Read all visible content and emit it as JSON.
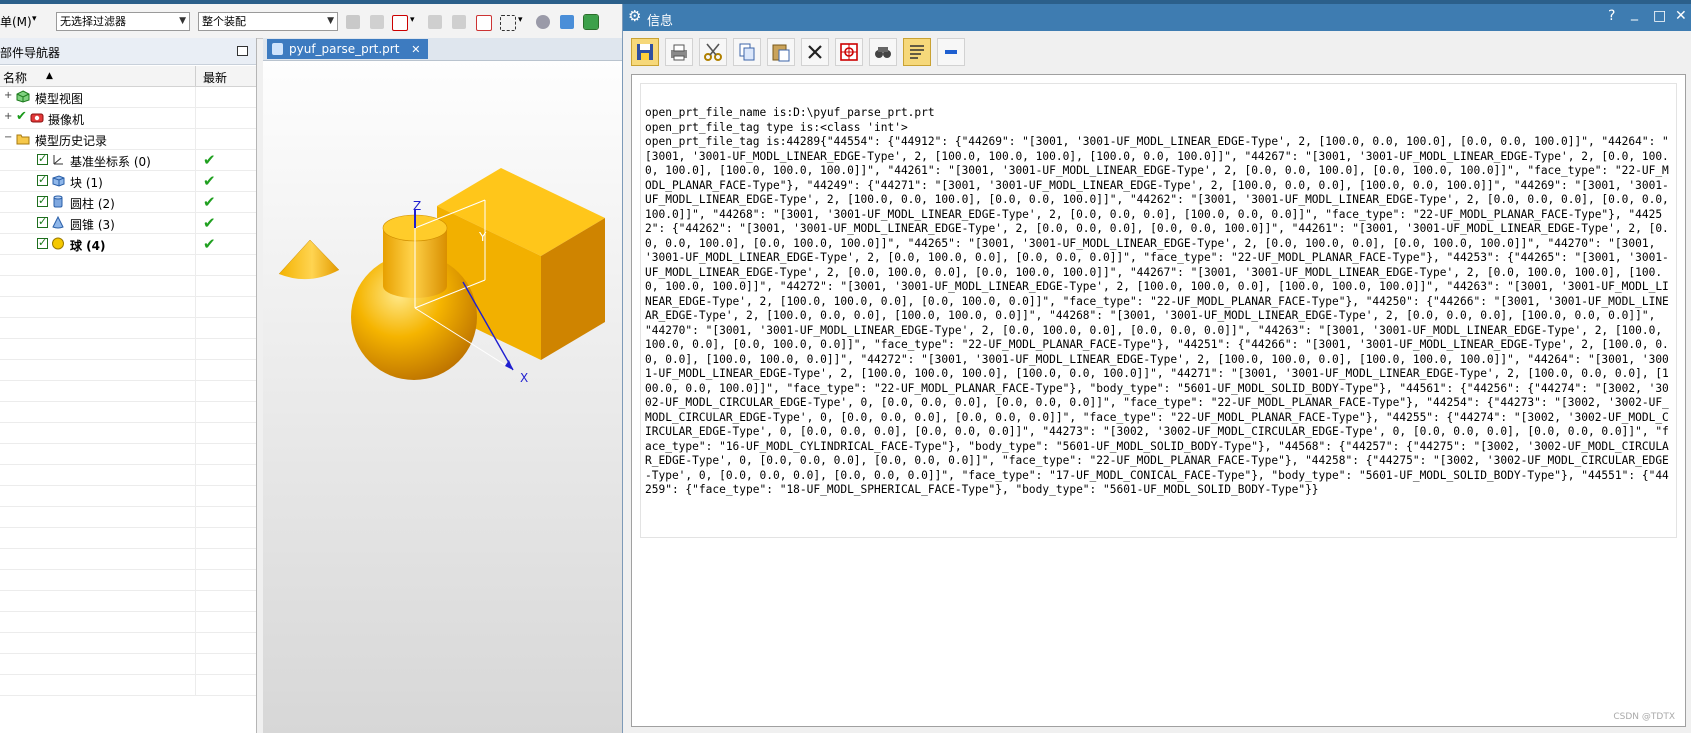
{
  "toolbar": {
    "menu_label": "单(M)",
    "filter_value": "无选择过滤器",
    "assembly_value": "整个装配"
  },
  "navigator": {
    "title": "部件导航器",
    "col_name": "名称",
    "col_latest": "最新",
    "latest_mark": "✔",
    "rows": [
      {
        "label": "模型视图",
        "icon": "model-views-icon"
      },
      {
        "label": "摄像机",
        "icon": "camera-icon"
      },
      {
        "label": "模型历史记录",
        "icon": "history-folder-icon"
      },
      {
        "label": "基准坐标系 (0)",
        "icon": "datum-csys-icon"
      },
      {
        "label": "块 (1)",
        "icon": "block-icon"
      },
      {
        "label": "圆柱 (2)",
        "icon": "cylinder-icon"
      },
      {
        "label": "圆锥 (3)",
        "icon": "cone-icon"
      },
      {
        "label": "球 (4)",
        "icon": "sphere-icon"
      }
    ]
  },
  "graphics": {
    "tab_label": "pyuf_parse_prt.prt",
    "axis_x": "X",
    "axis_y": "Y",
    "axis_z": "Z",
    "colors": {
      "solid": "#f5b400",
      "solid_dark": "#d98f00",
      "solid_light": "#ffd24a",
      "axis_blue": "#1f1fd0"
    }
  },
  "info_window": {
    "title": "信息",
    "help_glyph": "?",
    "minimize_glyph": "_",
    "maximize_glyph": "□",
    "close_glyph": "✕",
    "tool_icons": [
      "save-icon",
      "print-icon",
      "cut-icon",
      "copy-icon",
      "paste-icon",
      "delete-icon",
      "find-icon",
      "binoculars-icon",
      "wrap-text-icon",
      "minus-icon"
    ],
    "output_text": "open_prt_file_name is:D:\\pyuf_parse_prt.prt\nopen_prt_file_tag type is:<class 'int'>\nopen_prt_file_tag is:44289{\"44554\": {\"44912\": {\"44269\": \"[3001, '3001-UF_MODL_LINEAR_EDGE-Type', 2, [100.0, 0.0, 100.0], [0.0, 0.0, 100.0]]\", \"44264\": \"[3001, '3001-UF_MODL_LINEAR_EDGE-Type', 2, [100.0, 100.0, 100.0], [100.0, 0.0, 100.0]]\", \"44267\": \"[3001, '3001-UF_MODL_LINEAR_EDGE-Type', 2, [0.0, 100.0, 100.0], [100.0, 100.0, 100.0]]\", \"44261\": \"[3001, '3001-UF_MODL_LINEAR_EDGE-Type', 2, [0.0, 0.0, 100.0], [0.0, 100.0, 100.0]]\", \"face_type\": \"22-UF_MODL_PLANAR_FACE-Type\"}, \"44249\": {\"44271\": \"[3001, '3001-UF_MODL_LINEAR_EDGE-Type', 2, [100.0, 0.0, 0.0], [100.0, 0.0, 100.0]]\", \"44269\": \"[3001, '3001-UF_MODL_LINEAR_EDGE-Type', 2, [100.0, 0.0, 100.0], [0.0, 0.0, 100.0]]\", \"44262\": \"[3001, '3001-UF_MODL_LINEAR_EDGE-Type', 2, [0.0, 0.0, 0.0], [0.0, 0.0, 100.0]]\", \"44268\": \"[3001, '3001-UF_MODL_LINEAR_EDGE-Type', 2, [0.0, 0.0, 0.0], [100.0, 0.0, 0.0]]\", \"face_type\": \"22-UF_MODL_PLANAR_FACE-Type\"}, \"44252\": {\"44262\": \"[3001, '3001-UF_MODL_LINEAR_EDGE-Type', 2, [0.0, 0.0, 0.0], [0.0, 0.0, 100.0]]\", \"44261\": \"[3001, '3001-UF_MODL_LINEAR_EDGE-Type', 2, [0.0, 0.0, 100.0], [0.0, 100.0, 100.0]]\", \"44265\": \"[3001, '3001-UF_MODL_LINEAR_EDGE-Type', 2, [0.0, 100.0, 0.0], [0.0, 100.0, 100.0]]\", \"44270\": \"[3001, '3001-UF_MODL_LINEAR_EDGE-Type', 2, [0.0, 100.0, 0.0], [0.0, 0.0, 0.0]]\", \"face_type\": \"22-UF_MODL_PLANAR_FACE-Type\"}, \"44253\": {\"44265\": \"[3001, '3001-UF_MODL_LINEAR_EDGE-Type', 2, [0.0, 100.0, 0.0], [0.0, 100.0, 100.0]]\", \"44267\": \"[3001, '3001-UF_MODL_LINEAR_EDGE-Type', 2, [0.0, 100.0, 100.0], [100.0, 100.0, 100.0]]\", \"44272\": \"[3001, '3001-UF_MODL_LINEAR_EDGE-Type', 2, [100.0, 100.0, 0.0], [100.0, 100.0, 100.0]]\", \"44263\": \"[3001, '3001-UF_MODL_LINEAR_EDGE-Type', 2, [100.0, 100.0, 0.0], [0.0, 100.0, 0.0]]\", \"face_type\": \"22-UF_MODL_PLANAR_FACE-Type\"}, \"44250\": {\"44266\": \"[3001, '3001-UF_MODL_LINEAR_EDGE-Type', 2, [100.0, 0.0, 0.0], [100.0, 100.0, 0.0]]\", \"44268\": \"[3001, '3001-UF_MODL_LINEAR_EDGE-Type', 2, [0.0, 0.0, 0.0], [100.0, 0.0, 0.0]]\", \"44270\": \"[3001, '3001-UF_MODL_LINEAR_EDGE-Type', 2, [0.0, 100.0, 0.0], [0.0, 0.0, 0.0]]\", \"44263\": \"[3001, '3001-UF_MODL_LINEAR_EDGE-Type', 2, [100.0, 100.0, 0.0], [0.0, 100.0, 0.0]]\", \"face_type\": \"22-UF_MODL_PLANAR_FACE-Type\"}, \"44251\": {\"44266\": \"[3001, '3001-UF_MODL_LINEAR_EDGE-Type', 2, [100.0, 0.0, 0.0], [100.0, 100.0, 0.0]]\", \"44272\": \"[3001, '3001-UF_MODL_LINEAR_EDGE-Type', 2, [100.0, 100.0, 0.0], [100.0, 100.0, 100.0]]\", \"44264\": \"[3001, '3001-UF_MODL_LINEAR_EDGE-Type', 2, [100.0, 100.0, 100.0], [100.0, 0.0, 100.0]]\", \"44271\": \"[3001, '3001-UF_MODL_LINEAR_EDGE-Type', 2, [100.0, 0.0, 0.0], [100.0, 0.0, 100.0]]\", \"face_type\": \"22-UF_MODL_PLANAR_FACE-Type\"}, \"body_type\": \"5601-UF_MODL_SOLID_BODY-Type\"}, \"44561\": {\"44256\": {\"44274\": \"[3002, '3002-UF_MODL_CIRCULAR_EDGE-Type', 0, [0.0, 0.0, 0.0], [0.0, 0.0, 0.0]]\", \"face_type\": \"22-UF_MODL_PLANAR_FACE-Type\"}, \"44254\": {\"44273\": \"[3002, '3002-UF_MODL_CIRCULAR_EDGE-Type', 0, [0.0, 0.0, 0.0], [0.0, 0.0, 0.0]]\", \"face_type\": \"22-UF_MODL_PLANAR_FACE-Type\"}, \"44255\": {\"44274\": \"[3002, '3002-UF_MODL_CIRCULAR_EDGE-Type', 0, [0.0, 0.0, 0.0], [0.0, 0.0, 0.0]]\", \"44273\": \"[3002, '3002-UF_MODL_CIRCULAR_EDGE-Type', 0, [0.0, 0.0, 0.0], [0.0, 0.0, 0.0]]\", \"face_type\": \"16-UF_MODL_CYLINDRICAL_FACE-Type\"}, \"body_type\": \"5601-UF_MODL_SOLID_BODY-Type\"}, \"44568\": {\"44257\": {\"44275\": \"[3002, '3002-UF_MODL_CIRCULAR_EDGE-Type', 0, [0.0, 0.0, 0.0], [0.0, 0.0, 0.0]]\", \"face_type\": \"22-UF_MODL_PLANAR_FACE-Type\"}, \"44258\": {\"44275\": \"[3002, '3002-UF_MODL_CIRCULAR_EDGE-Type', 0, [0.0, 0.0, 0.0], [0.0, 0.0, 0.0]]\", \"face_type\": \"17-UF_MODL_CONICAL_FACE-Type\"}, \"body_type\": \"5601-UF_MODL_SOLID_BODY-Type\"}, \"44551\": {\"44259\": {\"face_type\": \"18-UF_MODL_SPHERICAL_FACE-Type\"}, \"body_type\": \"5601-UF_MODL_SOLID_BODY-Type\"}}",
    "watermark": "CSDN @TDTX"
  }
}
